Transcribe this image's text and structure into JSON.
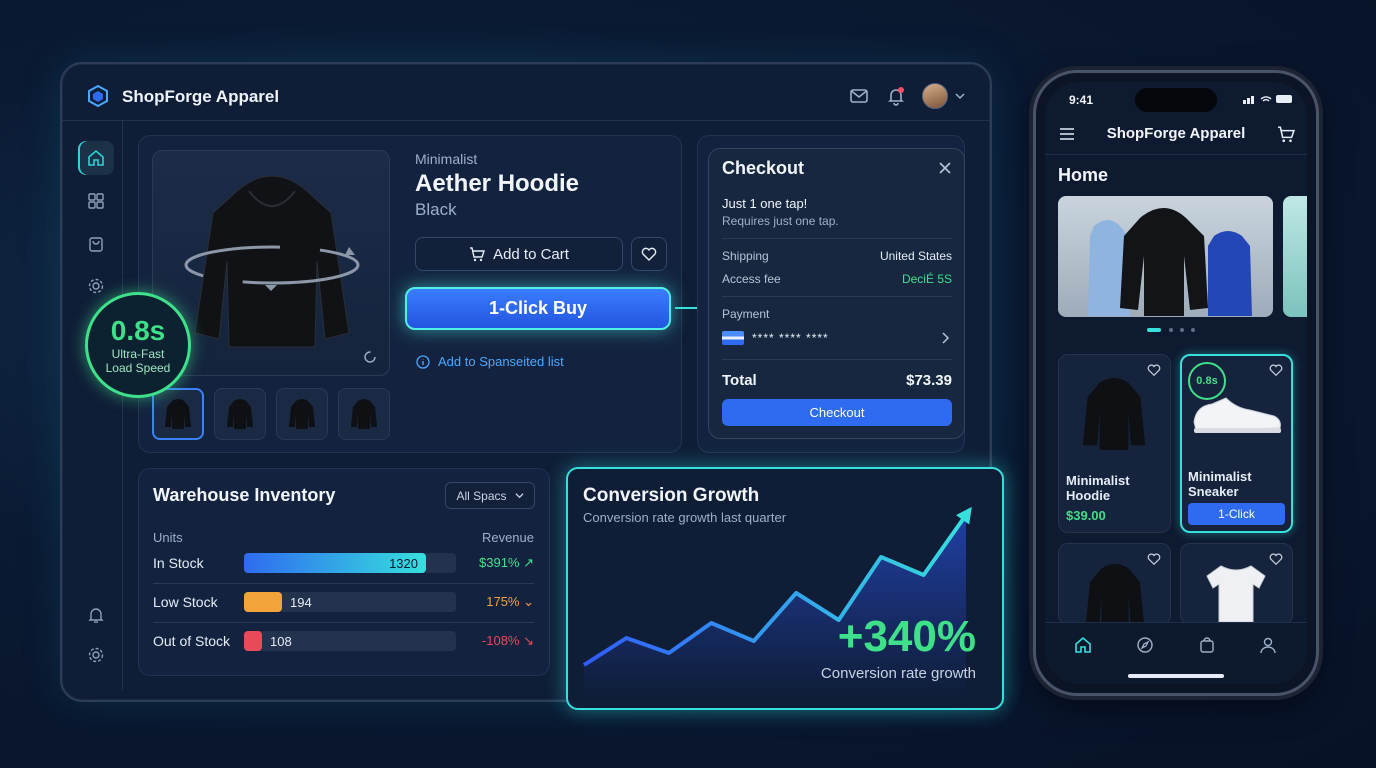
{
  "app": {
    "brand": "ShopForge Apparel"
  },
  "product": {
    "category": "Minimalist",
    "name": "Aether Hoodie",
    "color": "Black",
    "add_to_cart": "Add to Cart",
    "one_click": "1-Click Buy",
    "add_list": "Add to Spanseited list"
  },
  "speed": {
    "value": "0.8s",
    "label_line1": "Ultra-Fast",
    "label_line2": "Load Speed"
  },
  "checkout": {
    "title": "Checkout",
    "headline": "Just 1 one tap!",
    "sub": "Requires just one tap.",
    "shipping_label": "Shipping",
    "shipping_value": "United States",
    "fee_label": "Access fee",
    "fee_value": "DeciÉ 5S",
    "payment_label": "Payment",
    "card_mask": "**** **** ****",
    "total_label": "Total",
    "total_value": "$73.39",
    "button": "Checkout"
  },
  "inventory": {
    "title": "Warehouse Inventory",
    "filter": "All Spacs",
    "col_units": "Units",
    "col_revenue": "Revenue",
    "rows": [
      {
        "label": "In Stock",
        "units": "1320",
        "revenue": "$391% ↗",
        "fill": 0.86,
        "color": "#2f7cf0",
        "rev_color": "#3ee08c"
      },
      {
        "label": "Low Stock",
        "units": "194",
        "revenue": "175% ⌄",
        "fill": 0.18,
        "color": "#f2a33a",
        "rev_color": "#f2a33a"
      },
      {
        "label": "Out of Stock",
        "units": "108",
        "revenue": "-108% ↘",
        "fill": 0.08,
        "color": "#e84a5a",
        "rev_color": "#e84a5a"
      }
    ]
  },
  "growth": {
    "title": "Conversion Growth",
    "subtitle": "Conversion rate growth last quarter",
    "value": "+340%",
    "value_label": "Conversion rate growth"
  },
  "chart_data": {
    "type": "line",
    "title": "Conversion Growth",
    "series": [
      {
        "values": [
          0,
          18,
          8,
          28,
          16,
          48,
          30,
          72,
          60,
          100
        ]
      }
    ],
    "ylim": [
      0,
      100
    ]
  },
  "phone": {
    "time": "9:41",
    "title": "ShopForge Apparel",
    "section": "Home",
    "products": [
      {
        "name_line1": "Minimalist",
        "name_line2": "Hoodie",
        "price": "$39.00"
      },
      {
        "name_line1": "Minimalist",
        "name_line2": "Sneaker",
        "button": "1-Click",
        "badge": "0.8s"
      }
    ]
  },
  "colors": {
    "accent": "#36e0dd",
    "primary": "#2f6bf0",
    "success": "#3fe08a"
  }
}
